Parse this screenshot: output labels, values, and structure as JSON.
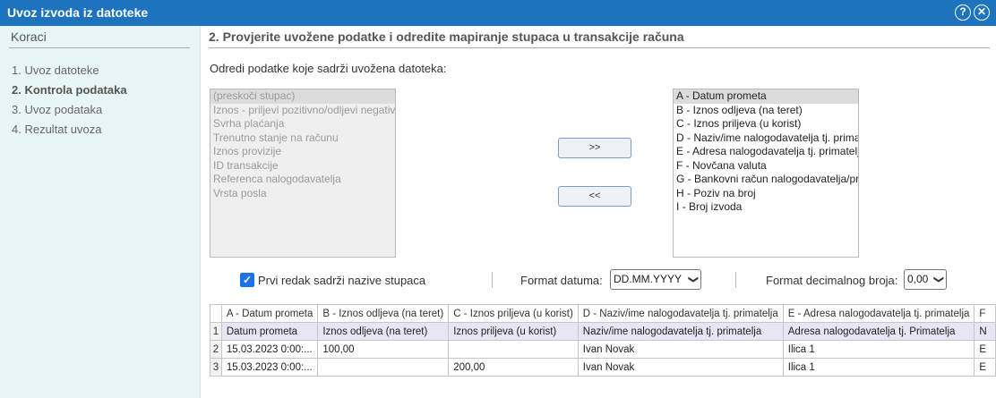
{
  "window": {
    "title": "Uvoz izvoda iz datoteke",
    "help_icon": "help-icon",
    "close_icon": "close-icon"
  },
  "sidebar": {
    "title": "Koraci",
    "steps": [
      {
        "label": "1. Uvoz datoteke",
        "active": false
      },
      {
        "label": "2. Kontrola podataka",
        "active": true
      },
      {
        "label": "3. Uvoz podataka",
        "active": false
      },
      {
        "label": "4. Rezultat uvoza",
        "active": false
      }
    ]
  },
  "main": {
    "heading": "2. Provjerite uvožene podatke i odredite mapiranje stupaca u transakcije računa",
    "intro": "Odredi podatke koje sadrži uvožena datoteka:",
    "available_fields": [
      "(preskoči stupac)",
      "Iznos - priljevi pozitivno/odljevi negativno",
      "Svrha plaćanja",
      "Trenutno stanje na računu",
      "Iznos provizije",
      "ID transakcije",
      "Referenca nalogodavatelja",
      "Vrsta posla"
    ],
    "mapped_fields": [
      "A - Datum prometa",
      "B - Iznos odljeva (na teret)",
      "C - Iznos priljeva (u korist)",
      "D - Naziv/ime nalogodavatelja tj. primatelja",
      "E - Adresa nalogodavatelja tj. primatelja",
      "F - Novčana valuta",
      "G - Bankovni račun nalogodavatelja/primatelja",
      "H - Poziv na broj",
      "I - Broj izvoda"
    ],
    "add_button": ">>",
    "remove_button": "<<"
  },
  "options": {
    "first_row_names_label": "Prvi redak sadrži nazive stupaca",
    "first_row_names_checked": true,
    "date_format_label": "Format datuma:",
    "date_format_value": "DD.MM.YYYY",
    "decimal_format_label": "Format decimalnog broja:",
    "decimal_format_value": "0,00"
  },
  "preview": {
    "columns": [
      "A - Datum prometa",
      "B - Iznos odljeva (na teret)",
      "C - Iznos priljeva (u korist)",
      "D - Naziv/ime nalogodavatelja tj. primatelja",
      "E - Adresa nalogodavatelja tj. primatelja",
      "F"
    ],
    "rows": [
      {
        "num": "1",
        "cells": [
          "Datum prometa",
          "Iznos odljeva (na teret)",
          "Iznos priljeva (u korist)",
          "Naziv/ime nalogodavatelja tj. primatelja",
          "Adresa nalogodavatelja tj. Primatelja",
          "N"
        ]
      },
      {
        "num": "2",
        "cells": [
          "15.03.2023 0:00:...",
          "100,00",
          "",
          "Ivan Novak",
          "Ilica 1",
          "E"
        ]
      },
      {
        "num": "3",
        "cells": [
          "15.03.2023 0:00:...",
          "",
          "200,00",
          "Ivan Novak",
          "Ilica 1",
          "E"
        ]
      }
    ]
  }
}
